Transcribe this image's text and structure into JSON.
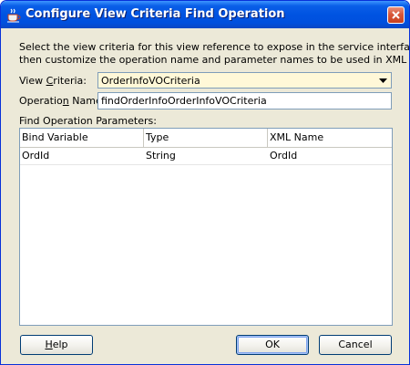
{
  "window": {
    "title": "Configure View Criteria Find Operation"
  },
  "description": {
    "line1": "Select the view criteria for this view reference to expose in the service interface,",
    "line2": "then customize the operation name and parameter names to be used in XML schema."
  },
  "form": {
    "view_criteria_label_pre": "View ",
    "view_criteria_label_mnemonic": "C",
    "view_criteria_label_post": "riteria:",
    "view_criteria_value": "OrderInfoVOCriteria",
    "operation_name_label_pre": "Operatio",
    "operation_name_label_mnemonic": "n",
    "operation_name_label_post": " Name:",
    "operation_name_value": "findOrderInfoOrderInfoVOCriteria",
    "params_label": "Find Operation Parameters:"
  },
  "table": {
    "headers": [
      "Bind Variable",
      "Type",
      "XML Name"
    ],
    "rows": [
      [
        "OrdId",
        "String",
        "OrdId"
      ]
    ]
  },
  "buttons": {
    "help_mnemonic": "H",
    "help_rest": "elp",
    "ok": "OK",
    "cancel": "Cancel"
  },
  "colors": {
    "titlebar": "#0053e1",
    "dialog_bg": "#ece9d8",
    "combo_bg": "#fff8d8",
    "close_button": "#d8573a"
  }
}
